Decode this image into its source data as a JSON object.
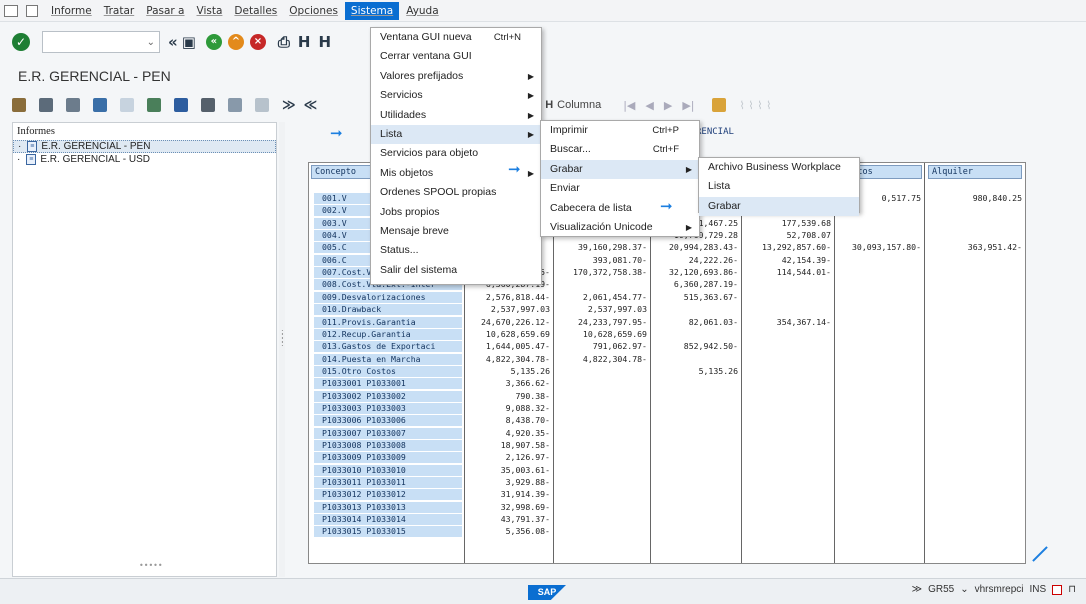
{
  "menubar": {
    "items": [
      "Informe",
      "Tratar",
      "Pasar a",
      "Vista",
      "Detalles",
      "Opciones",
      "Sistema",
      "Ayuda"
    ],
    "active": "Sistema"
  },
  "window_title": "E.R. GERENCIAL - PEN",
  "tree": {
    "header": "Informes",
    "items": [
      "E.R. GERENCIAL - PEN",
      "E.R. GERENCIAL - USD"
    ]
  },
  "toolbar2": {
    "column_label": "Columna"
  },
  "report": {
    "title": "RENCIAL",
    "headers": {
      "concept": "Concepto",
      "col5": "tratos",
      "col6": "Alquiler"
    },
    "rows": [
      {
        "label": "001.V",
        "c1": "",
        "c2": "",
        "c3": "",
        "c4": "",
        "c5": "0,517.75",
        "c6": "980,840.25"
      },
      {
        "label": "002.V",
        "c1": "",
        "c2": "",
        "c3": "",
        "c4": "",
        "c5": "",
        "c6": ""
      },
      {
        "label": "003.V",
        "c1": "",
        "c2": "",
        "c3": "1,467.25",
        "c4": "177,539.68",
        "c5": "",
        "c6": ""
      },
      {
        "label": "004.V",
        "c1": "",
        "c2": "",
        "c3": "10,760,729.28",
        "c4": "52,708.07",
        "c5": "",
        "c6": ""
      },
      {
        "label": "005.C",
        "c1": "",
        "c2": "39,160,298.37-",
        "c3": "20,994,283.43-",
        "c4": "13,292,857.60-",
        "c5": "30,093,157.80-",
        "c6": "363,951.42-"
      },
      {
        "label": "006.C",
        "c1": "",
        "c2": "393,081.70-",
        "c3": "24,222.26-",
        "c4": "42,154.39-",
        "c5": "",
        "c6": ""
      },
      {
        "label": "007.Cost.Vta.Ext.-Terc.",
        "c1": "202,607,996.25-",
        "c2": "170,372,758.38-",
        "c3": "32,120,693.86-",
        "c4": "114,544.01-",
        "c5": "",
        "c6": ""
      },
      {
        "label": "008.Cost.Vta.Ext.-Inter",
        "c1": "6,360,287.19-",
        "c2": "",
        "c3": "6,360,287.19-",
        "c4": "",
        "c5": "",
        "c6": ""
      },
      {
        "label": "009.Desvalorizaciones",
        "c1": "2,576,818.44-",
        "c2": "2,061,454.77-",
        "c3": "515,363.67-",
        "c4": "",
        "c5": "",
        "c6": ""
      },
      {
        "label": "010.Drawback",
        "c1": "2,537,997.03",
        "c2": "2,537,997.03",
        "c3": "",
        "c4": "",
        "c5": "",
        "c6": ""
      },
      {
        "label": "011.Provis.Garantia",
        "c1": "24,670,226.12-",
        "c2": "24,233,797.95-",
        "c3": "82,061.03-",
        "c4": "354,367.14-",
        "c5": "",
        "c6": ""
      },
      {
        "label": "012.Recup.Garantia",
        "c1": "10,628,659.69",
        "c2": "10,628,659.69",
        "c3": "",
        "c4": "",
        "c5": "",
        "c6": ""
      },
      {
        "label": "013.Gastos de Exportaci",
        "c1": "1,644,005.47-",
        "c2": "791,062.97-",
        "c3": "852,942.50-",
        "c4": "",
        "c5": "",
        "c6": ""
      },
      {
        "label": "014.Puesta en Marcha",
        "c1": "4,822,304.78-",
        "c2": "4,822,304.78-",
        "c3": "",
        "c4": "",
        "c5": "",
        "c6": ""
      },
      {
        "label": "015.Otro Costos",
        "c1": "5,135.26",
        "c2": "",
        "c3": "5,135.26",
        "c4": "",
        "c5": "",
        "c6": ""
      },
      {
        "label": "P1033001  P1033001",
        "c1": "3,366.62-",
        "c2": "",
        "c3": "",
        "c4": "",
        "c5": "",
        "c6": ""
      },
      {
        "label": "P1033002  P1033002",
        "c1": "790.38-",
        "c2": "",
        "c3": "",
        "c4": "",
        "c5": "",
        "c6": ""
      },
      {
        "label": "P1033003  P1033003",
        "c1": "9,088.32-",
        "c2": "",
        "c3": "",
        "c4": "",
        "c5": "",
        "c6": ""
      },
      {
        "label": "P1033006  P1033006",
        "c1": "8,438.70-",
        "c2": "",
        "c3": "",
        "c4": "",
        "c5": "",
        "c6": ""
      },
      {
        "label": "P1033007  P1033007",
        "c1": "4,920.35-",
        "c2": "",
        "c3": "",
        "c4": "",
        "c5": "",
        "c6": ""
      },
      {
        "label": "P1033008  P1033008",
        "c1": "18,907.58-",
        "c2": "",
        "c3": "",
        "c4": "",
        "c5": "",
        "c6": ""
      },
      {
        "label": "P1033009  P1033009",
        "c1": "2,126.97-",
        "c2": "",
        "c3": "",
        "c4": "",
        "c5": "",
        "c6": ""
      },
      {
        "label": "P1033010  P1033010",
        "c1": "35,003.61-",
        "c2": "",
        "c3": "",
        "c4": "",
        "c5": "",
        "c6": ""
      },
      {
        "label": "P1033011  P1033011",
        "c1": "3,929.88-",
        "c2": "",
        "c3": "",
        "c4": "",
        "c5": "",
        "c6": ""
      },
      {
        "label": "P1033012  P1033012",
        "c1": "31,914.39-",
        "c2": "",
        "c3": "",
        "c4": "",
        "c5": "",
        "c6": ""
      },
      {
        "label": "P1033013  P1033013",
        "c1": "32,998.69-",
        "c2": "",
        "c3": "",
        "c4": "",
        "c5": "",
        "c6": ""
      },
      {
        "label": "P1033014  P1033014",
        "c1": "43,791.37-",
        "c2": "",
        "c3": "",
        "c4": "",
        "c5": "",
        "c6": ""
      },
      {
        "label": "P1033015  P1033015",
        "c1": "5,356.08-",
        "c2": "",
        "c3": "",
        "c4": "",
        "c5": "",
        "c6": ""
      }
    ]
  },
  "menus": {
    "sistema": [
      {
        "label": "Ventana GUI nueva",
        "shortcut": "Ctrl+N",
        "submenu": false
      },
      {
        "label": "Cerrar ventana GUI",
        "shortcut": "",
        "submenu": false
      },
      {
        "label": "Valores prefijados",
        "shortcut": "",
        "submenu": true
      },
      {
        "label": "Servicios",
        "shortcut": "",
        "submenu": true
      },
      {
        "label": "Utilidades",
        "shortcut": "",
        "submenu": true
      },
      {
        "label": "Lista",
        "shortcut": "",
        "submenu": true
      },
      {
        "label": "Servicios para objeto",
        "shortcut": "",
        "submenu": false
      },
      {
        "label": "Mis objetos",
        "shortcut": "",
        "submenu": true
      },
      {
        "label": "Ordenes SPOOL propias",
        "shortcut": "",
        "submenu": false
      },
      {
        "label": "Jobs propios",
        "shortcut": "",
        "submenu": false
      },
      {
        "label": "Mensaje breve",
        "shortcut": "",
        "submenu": false
      },
      {
        "label": "Status...",
        "shortcut": "",
        "submenu": false
      },
      {
        "label": "Salir del sistema",
        "shortcut": "",
        "submenu": false
      }
    ],
    "lista": [
      {
        "label": "Imprimir",
        "shortcut": "Ctrl+P",
        "submenu": false
      },
      {
        "label": "Buscar...",
        "shortcut": "Ctrl+F",
        "submenu": false
      },
      {
        "label": "Grabar",
        "shortcut": "",
        "submenu": true
      },
      {
        "label": "Enviar",
        "shortcut": "",
        "submenu": false
      },
      {
        "label": "Cabecera de lista",
        "shortcut": "",
        "submenu": false
      },
      {
        "label": "Visualización Unicode",
        "shortcut": "",
        "submenu": true
      }
    ],
    "grabar": [
      {
        "label": "Archivo Business Workplace"
      },
      {
        "label": "Lista"
      },
      {
        "label": "Grabar"
      }
    ]
  },
  "status": {
    "system": "GR55",
    "server": "vhrsmrepci",
    "mode": "INS"
  },
  "colors": {
    "accent": "#0a6ed1",
    "row_label_bg": "#c8dff5",
    "menu_highlight": "#dce8f5"
  }
}
